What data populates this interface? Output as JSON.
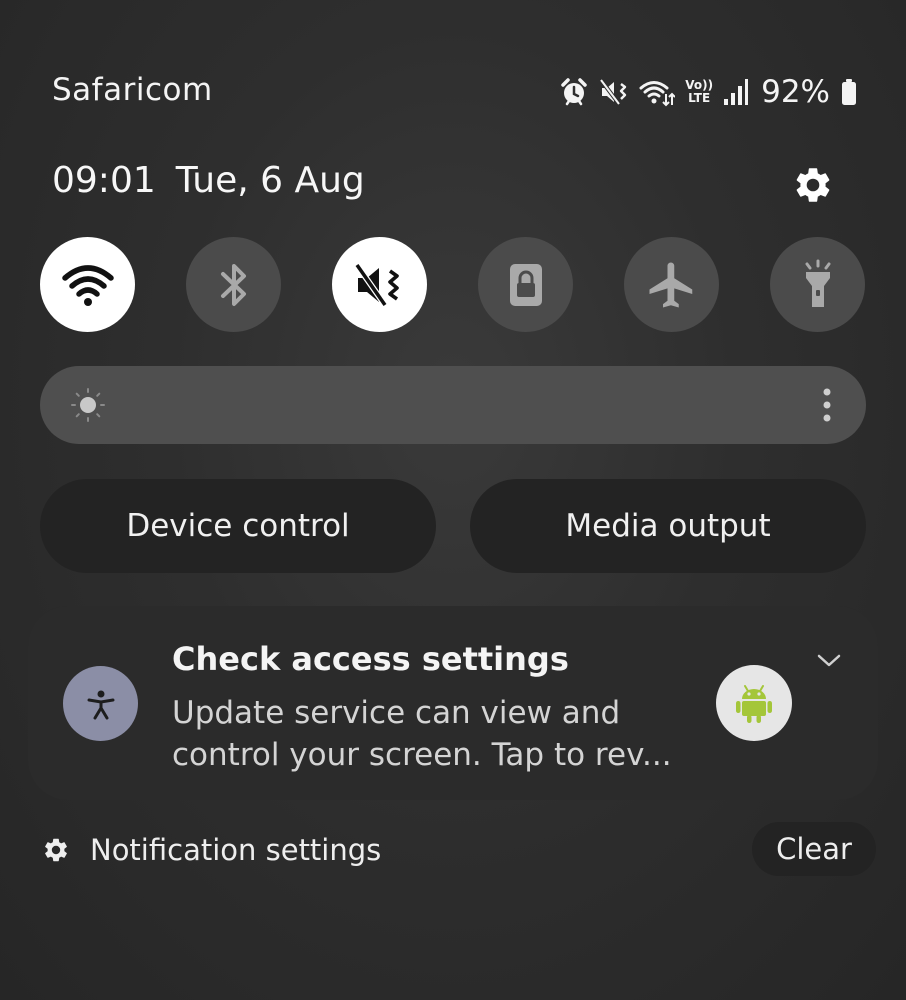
{
  "status_bar": {
    "carrier": "Safaricom",
    "icons": [
      "alarm-icon",
      "mute-vibrate-icon",
      "wifi-data-icon",
      "volte-lte-icon",
      "signal-icon",
      "battery-icon"
    ],
    "volte_top": "Vo))",
    "volte_bottom": "LTE",
    "battery": "92%"
  },
  "header": {
    "time": "09:01",
    "date": "Tue, 6 Aug"
  },
  "quick_settings": [
    {
      "name": "wifi",
      "icon": "wifi-icon",
      "active": true
    },
    {
      "name": "bluetooth",
      "icon": "bluetooth-icon",
      "active": false
    },
    {
      "name": "sound-mode",
      "icon": "mute-icon",
      "active": true
    },
    {
      "name": "secure-folder",
      "icon": "lock-icon",
      "active": false
    },
    {
      "name": "airplane-mode",
      "icon": "airplane-icon",
      "active": false
    },
    {
      "name": "flashlight",
      "icon": "flashlight-icon",
      "active": false
    }
  ],
  "buttons": {
    "device_control": "Device control",
    "media_output": "Media output"
  },
  "notification": {
    "title": "Check access settings",
    "body": "Update service can view and control your screen. Tap to rev..."
  },
  "footer": {
    "notification_settings": "Notification settings",
    "clear": "Clear"
  },
  "colors": {
    "tile_on": "#ffffff",
    "tile_off": "#4b4b4b",
    "accessibility_badge": "#8b8ea6",
    "android_green": "#a4c639"
  }
}
